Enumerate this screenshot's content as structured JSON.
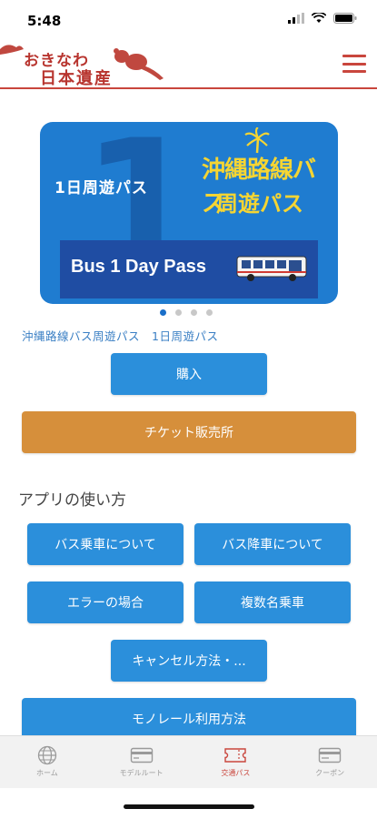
{
  "status_bar": {
    "time": "5:48"
  },
  "header": {
    "logo_line1": "おきなわ",
    "logo_line2": "日本遺産"
  },
  "banner": {
    "big_number": "1",
    "title_ja": "1日周遊パス",
    "yellow_line1": "沖縄路線バス",
    "yellow_line2": "周遊パス",
    "title_en": "Bus 1 Day Pass"
  },
  "carousel": {
    "count": 4,
    "active": 0
  },
  "pass_caption": "沖縄路線バス周遊パス　1日周遊パス",
  "buttons": {
    "purchase": "購入",
    "ticket_office": "チケット販売所"
  },
  "howto": {
    "title": "アプリの使い方",
    "boarding": "バス乗車について",
    "alighting": "バス降車について",
    "error": "エラーの場合",
    "multiple": "複数名乗車",
    "cancel": "キャンセル方法・...",
    "monorail": "モノレール利用方法"
  },
  "tab_bar": {
    "items": [
      {
        "label": "ホーム",
        "icon": "globe-icon"
      },
      {
        "label": "モデルルート",
        "icon": "card-icon"
      },
      {
        "label": "交通パス",
        "icon": "ticket-icon"
      },
      {
        "label": "クーポン",
        "icon": "coupon-icon"
      }
    ],
    "active": "交通パス"
  },
  "colors": {
    "accent_red": "#c9463d",
    "button_blue": "#2b8fdb",
    "button_orange": "#d68f3b",
    "banner_blue": "#1f7cd0"
  }
}
